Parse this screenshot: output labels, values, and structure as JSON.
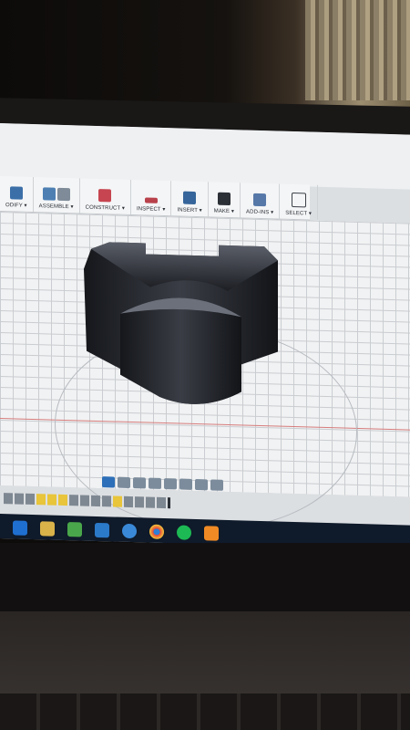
{
  "toolbar": {
    "items": [
      {
        "label": "ODIFY ▾",
        "icon": "modify-icon"
      },
      {
        "label": "ASSEMBLE ▾",
        "icon": "assemble-icon"
      },
      {
        "label": "CONSTRUCT ▾",
        "icon": "construct-icon"
      },
      {
        "label": "INSPECT ▾",
        "icon": "inspect-icon"
      },
      {
        "label": "INSERT ▾",
        "icon": "insert-icon"
      },
      {
        "label": "MAKE ▾",
        "icon": "make-icon"
      },
      {
        "label": "ADD-INS ▾",
        "icon": "add-ins-icon"
      },
      {
        "label": "SELECT ▾",
        "icon": "select-icon"
      }
    ]
  },
  "colors": {
    "toolbar_bg": "#f4f5f6",
    "canvas_bg": "#f1f2f3",
    "grid": "#c9ccd0",
    "x_axis": "#d77c7c",
    "model": "#23252b",
    "taskbar": "#0f1a2a",
    "timeline_highlight": "#e8c53a"
  },
  "taskbar_icons": [
    "edge-icon",
    "file-explorer-icon",
    "security-icon",
    "store-icon",
    "app-icon",
    "chrome-icon",
    "spotify-icon",
    "fusion-360-icon"
  ]
}
